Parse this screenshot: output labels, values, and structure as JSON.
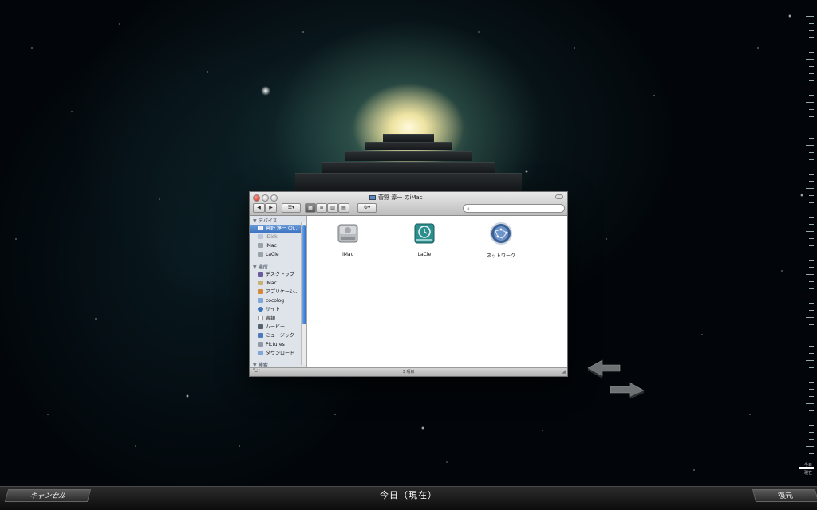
{
  "finder": {
    "title": "菅野 淳一 のiMac",
    "sidebar": {
      "devices_header": "デバイス",
      "devices": [
        {
          "label": "菅野 淳一 のi...",
          "icon": "imac-icon",
          "selected": true
        },
        {
          "label": "iDisk",
          "icon": "idisk-icon",
          "selected": false
        },
        {
          "label": "iMac",
          "icon": "hard-drive-icon",
          "selected": false
        },
        {
          "label": "LaCie",
          "icon": "hard-drive-icon",
          "selected": false
        }
      ],
      "places_header": "場所",
      "places": [
        {
          "label": "デスクトップ",
          "icon": "desktop-icon"
        },
        {
          "label": "iMac",
          "icon": "home-icon"
        },
        {
          "label": "アプリケーシ...",
          "icon": "applications-icon"
        },
        {
          "label": "cocolog",
          "icon": "folder-icon"
        },
        {
          "label": "サイト",
          "icon": "sites-icon"
        },
        {
          "label": "書類",
          "icon": "documents-icon"
        },
        {
          "label": "ムービー",
          "icon": "movies-icon"
        },
        {
          "label": "ミュージック",
          "icon": "music-icon"
        },
        {
          "label": "Pictures",
          "icon": "pictures-icon"
        },
        {
          "label": "ダウンロード",
          "icon": "downloads-icon"
        }
      ],
      "search_header": "検索"
    },
    "items": [
      {
        "label": "iMac",
        "icon": "hard-drive-icon"
      },
      {
        "label": "LaCie",
        "icon": "time-machine-drive-icon"
      },
      {
        "label": "ネットワーク",
        "icon": "network-icon"
      }
    ],
    "status": "3 項目"
  },
  "timeline": {
    "today_label": "今日",
    "now_label": "現在"
  },
  "bottom_bar": {
    "cancel_label": "キャンセル",
    "date_label": "今日（現在）",
    "restore_label": "復元"
  }
}
